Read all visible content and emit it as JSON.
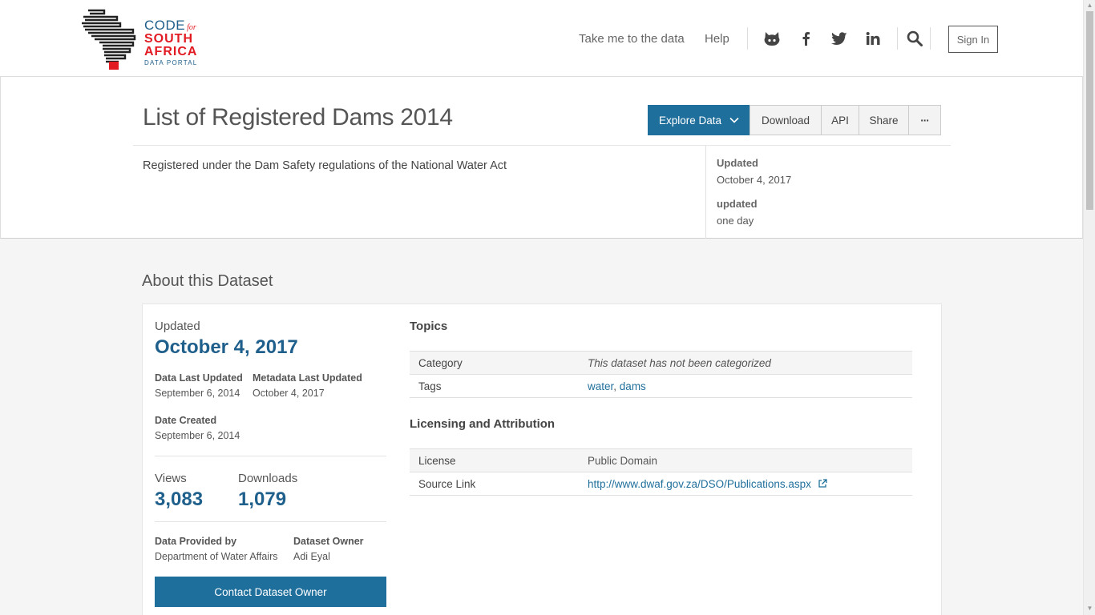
{
  "brand": {
    "code": "CODE",
    "for": "for",
    "south": "SOUTH",
    "africa": "AFRICA",
    "data_portal": "DATA PORTAL",
    "colors": {
      "blue": "#1f5f8b",
      "red": "#e21b23"
    }
  },
  "nav": {
    "take_me": "Take me to the data",
    "help": "Help",
    "social_icons": [
      "github-icon",
      "facebook-icon",
      "twitter-icon",
      "linkedin-icon",
      "search-icon"
    ],
    "sign_in": "Sign In"
  },
  "dataset": {
    "title": "List of Registered Dams 2014",
    "description": "Registered under the Dam Safety regulations of the National Water Act",
    "actions": {
      "explore": "Explore Data",
      "download": "Download",
      "api": "API",
      "share": "Share",
      "more": "···"
    },
    "meta": {
      "updated_label": "Updated",
      "updated_value": "October 4, 2017",
      "frequency_label": "updated",
      "frequency_value": "one day"
    }
  },
  "about": {
    "heading": "About this Dataset",
    "updated_label": "Updated",
    "updated_value": "October 4, 2017",
    "data_last_updated_label": "Data Last Updated",
    "data_last_updated_value": "September 6, 2014",
    "metadata_last_updated_label": "Metadata Last Updated",
    "metadata_last_updated_value": "October 4, 2017",
    "date_created_label": "Date Created",
    "date_created_value": "September 6, 2014",
    "views_label": "Views",
    "views_value": "3,083",
    "downloads_label": "Downloads",
    "downloads_value": "1,079",
    "provided_by_label": "Data Provided by",
    "provided_by_value": "Department of Water Affairs",
    "owner_label": "Dataset Owner",
    "owner_value": "Adi Eyal",
    "contact_button": "Contact Dataset Owner",
    "topics": {
      "heading": "Topics",
      "category_label": "Category",
      "category_value": "This dataset has not been categorized",
      "tags_label": "Tags",
      "tags": [
        "water",
        "dams"
      ],
      "tag_sep": ", "
    },
    "licensing": {
      "heading": "Licensing and Attribution",
      "license_label": "License",
      "license_value": "Public Domain",
      "source_label": "Source Link",
      "source_value": "http://www.dwaf.gov.za/DSO/Publications.aspx"
    }
  },
  "accent_color": "#1f6f9c"
}
